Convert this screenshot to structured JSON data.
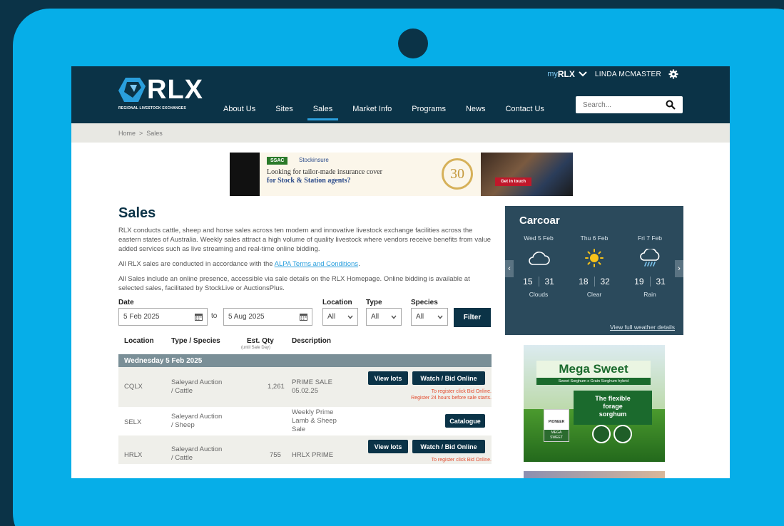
{
  "header": {
    "logo_word": "RLX",
    "logo_tagline": "REGIONAL LIVESTOCK EXCHANGES",
    "myrlx_prefix": "my",
    "myrlx_brand": "RLX",
    "user_name": "LINDA MCMASTER",
    "nav": [
      "About Us",
      "Sites",
      "Sales",
      "Market Info",
      "Programs",
      "News",
      "Contact Us"
    ],
    "active_nav": "Sales",
    "search_placeholder": "Search..."
  },
  "breadcrumb": {
    "home": "Home",
    "separator": ">",
    "current": "Sales"
  },
  "banner": {
    "ssac": "SSAC",
    "stockinsure": "Stockinsure",
    "line1": "Looking for tailor-made insurance cover",
    "line2": "for Stock & Station agents?",
    "badge": "30",
    "cta": "Get in touch"
  },
  "main": {
    "title": "Sales",
    "para1": "RLX conducts cattle, sheep and horse sales across ten modern and innovative livestock exchange facilities across the eastern states of Australia.  Weekly sales attract a high volume of quality livestock where vendors receive benefits from value added services such as live streaming and real-time online bidding.",
    "para2_prefix": "All RLX sales are conducted in accordance with the ",
    "para2_link": "ALPA Terms and Conditions",
    "para2_suffix": ".",
    "para3": "All Sales include an online presence, accessible via sale details on the RLX Homepage. Online bidding is available at selected sales, facilitated by StockLive or AuctionsPlus."
  },
  "filters": {
    "date_label": "Date",
    "date_from": "5 Feb 2025",
    "to": "to",
    "date_to": "5 Aug 2025",
    "location_label": "Location",
    "location_value": "All",
    "type_label": "Type",
    "type_value": "All",
    "species_label": "Species",
    "species_value": "All",
    "filter_button": "Filter"
  },
  "table": {
    "headers": {
      "location": "Location",
      "type": "Type / Species",
      "qty": "Est. Qty",
      "qty_sub": "(until Sale Day)",
      "description": "Description"
    },
    "day": "Wednesday 5 Feb 2025",
    "rows": [
      {
        "location": "CQLX",
        "type1": "Saleyard Auction",
        "type2": "/ Cattle",
        "qty": "1,261",
        "desc1": "PRIME SALE",
        "desc2": "05.02.25",
        "desc3": "",
        "view_lots": "View lots",
        "watch": "Watch / Bid Online",
        "reg1": "To register click Bid Online.",
        "reg2": "Register 24 hours before sale starts."
      },
      {
        "location": "SELX",
        "type1": "Saleyard Auction",
        "type2": "/ Sheep",
        "qty": "",
        "desc1": "Weekly Prime",
        "desc2": "Lamb & Sheep",
        "desc3": "Sale",
        "catalogue": "Catalogue"
      },
      {
        "location": "HRLX",
        "type1": "Saleyard Auction",
        "type2": "/ Cattle",
        "qty": "755",
        "desc1": "HRLX PRIME",
        "view_lots": "View lots",
        "watch": "Watch / Bid Online",
        "reg1": "To register click Bid Online."
      }
    ]
  },
  "weather": {
    "city": "Carcoar",
    "days": [
      {
        "day": "Wed 5 Feb",
        "icon": "cloud-icon",
        "min": "15",
        "max": "31",
        "cond": "Clouds"
      },
      {
        "day": "Thu 6 Feb",
        "icon": "sun-icon",
        "min": "18",
        "max": "32",
        "cond": "Clear"
      },
      {
        "day": "Fri 7 Feb",
        "icon": "rain-icon",
        "min": "19",
        "max": "31",
        "cond": "Rain"
      }
    ],
    "link": "View full weather details"
  },
  "ad": {
    "title": "Mega Sweet",
    "subtitle": "Sweet Sorghum x Grain Sorghum hybrid",
    "line1": "The flexible",
    "line2": "forage",
    "line3": "sorghum",
    "pioneer": "PIONEER",
    "product1": "MEGA",
    "product2": "SWEET"
  },
  "colors": {
    "navy": "#0b3347",
    "device": "#06aee8",
    "accent": "#2a9fdd",
    "alert": "#e34b2e"
  }
}
